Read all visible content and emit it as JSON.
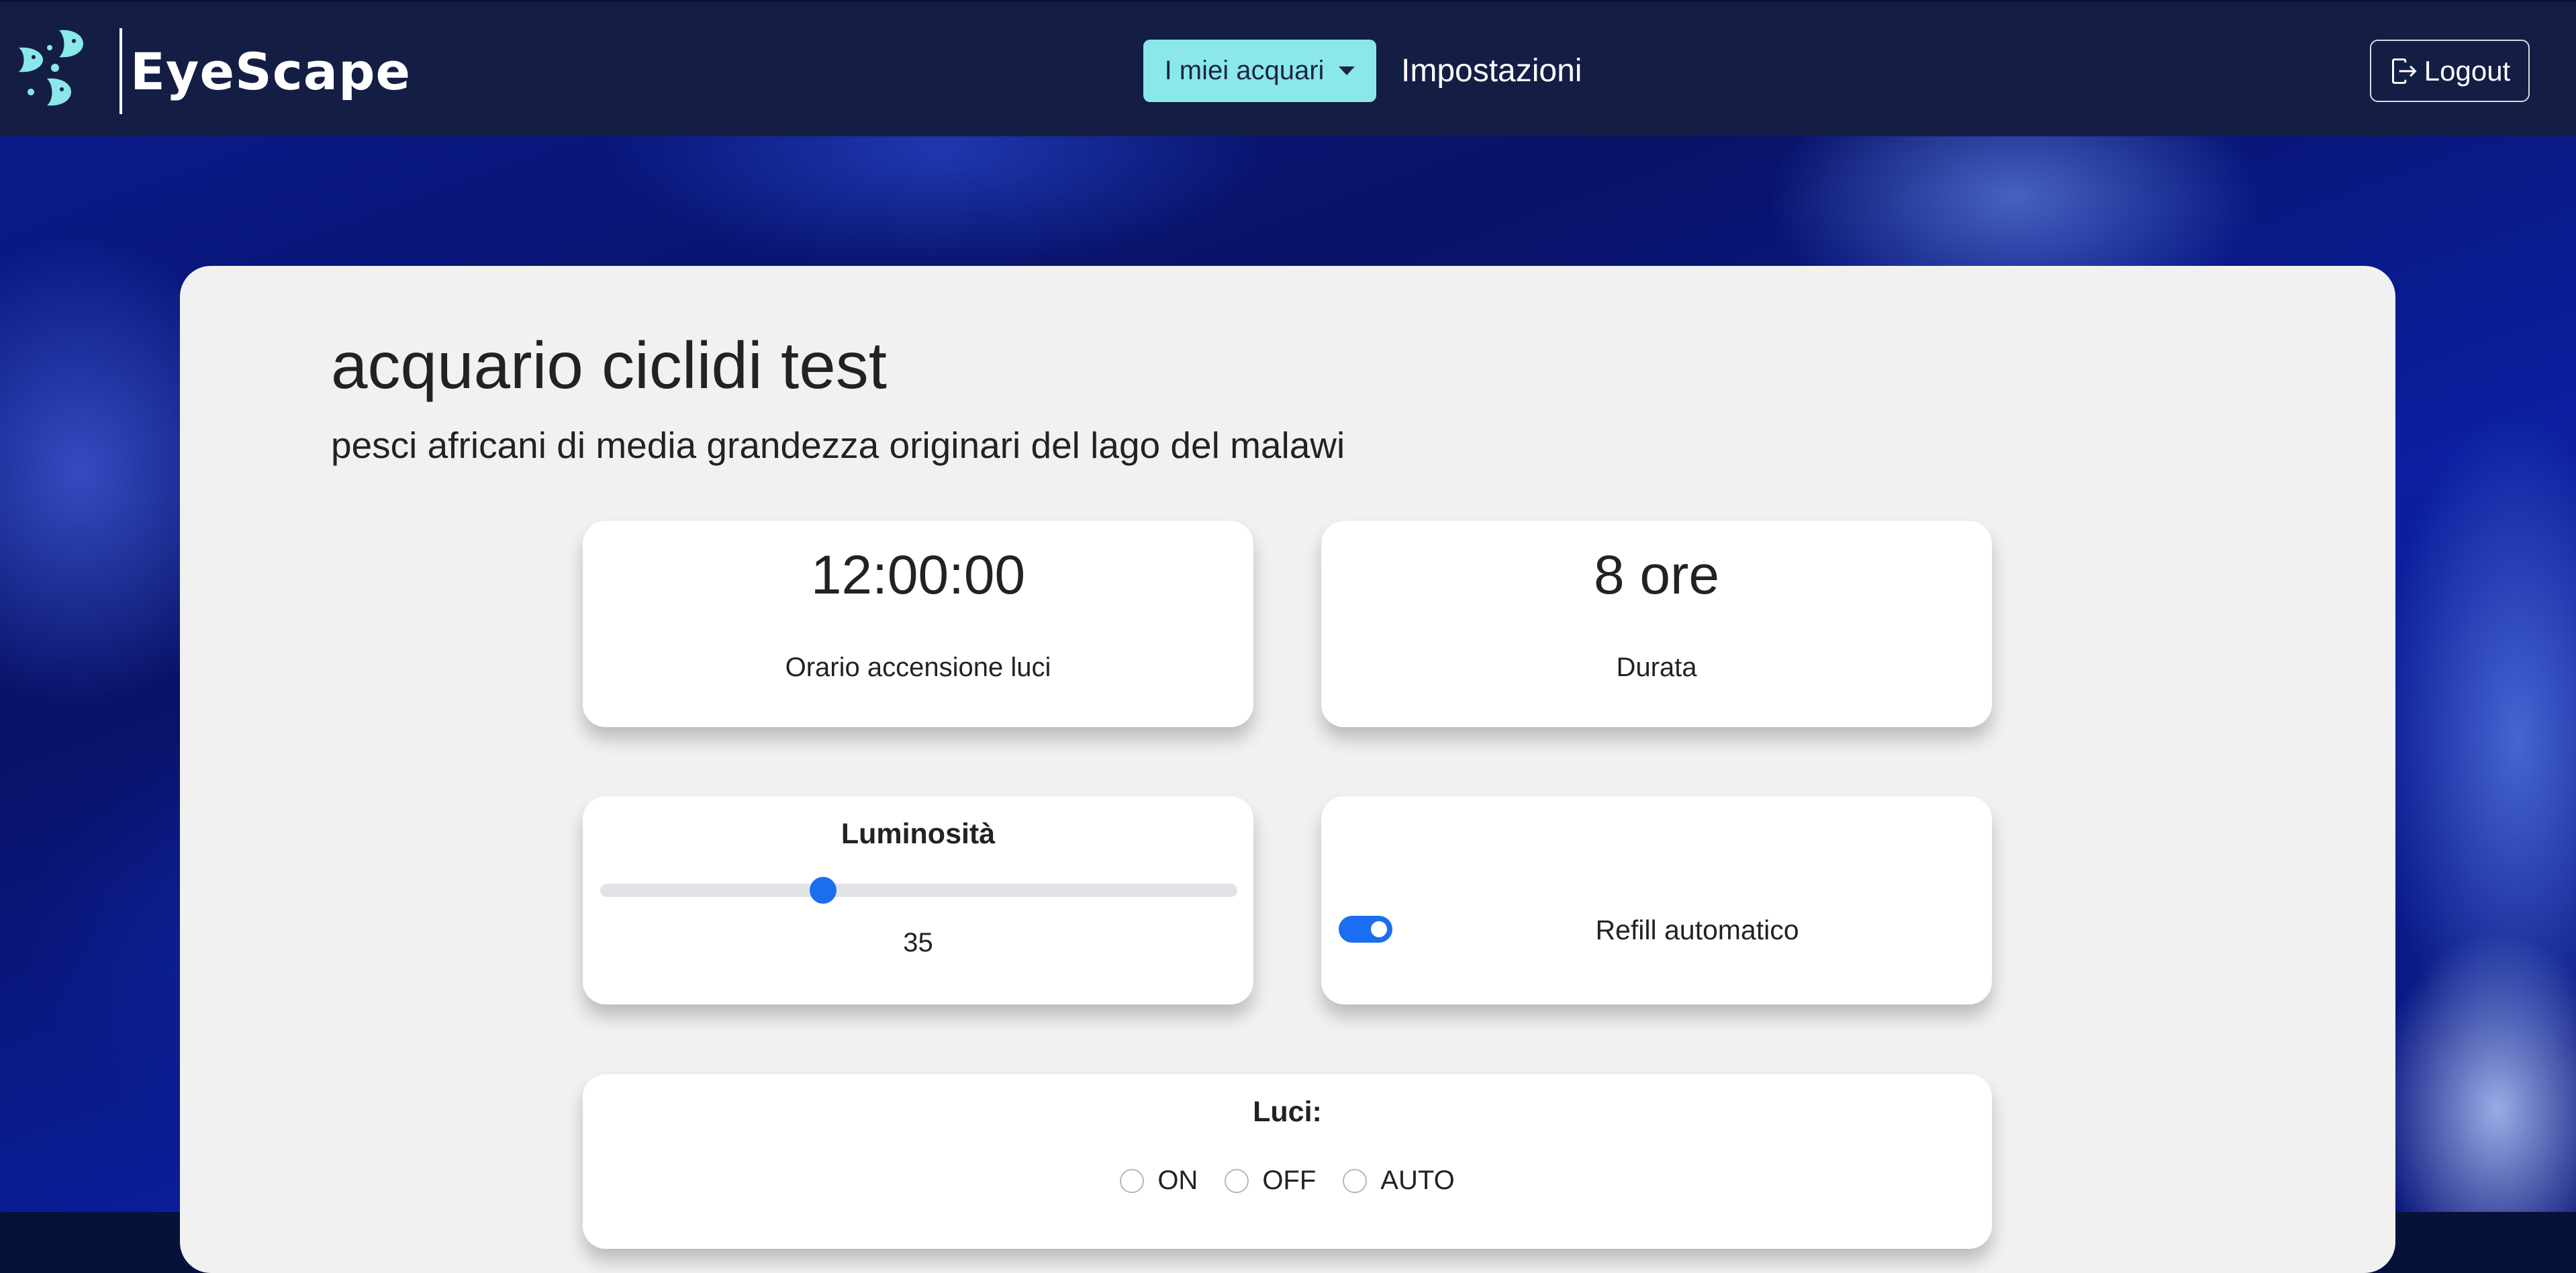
{
  "navbar": {
    "brand_name": "EyeScape",
    "dropdown_label": "I miei acquari",
    "settings_link": "Impostazioni",
    "logout_label": "Logout"
  },
  "aquarium": {
    "title": "acquario ciclidi test",
    "description": "pesci africani di media grandezza originari del lago del malawi"
  },
  "lights_on": {
    "value": "12:00:00",
    "label": "Orario accensione luci"
  },
  "duration": {
    "value": "8 ore",
    "label": "Durata"
  },
  "brightness": {
    "heading": "Luminosità",
    "value": "35",
    "min": 0,
    "max": 100
  },
  "refill": {
    "label": "Refill automatico",
    "enabled": true
  },
  "lights_mode": {
    "heading": "Luci:",
    "options": [
      "ON",
      "OFF",
      "AUTO"
    ],
    "selected": null
  },
  "colors": {
    "navbar_bg": "#141e45",
    "accent": "#8ae8ea",
    "primary": "#1a6ef0",
    "panel_bg": "#f1f1f1"
  },
  "icons": {
    "logo": "fish-logo-icon",
    "dropdown": "caret-down-icon",
    "logout": "box-arrow-right-icon"
  }
}
